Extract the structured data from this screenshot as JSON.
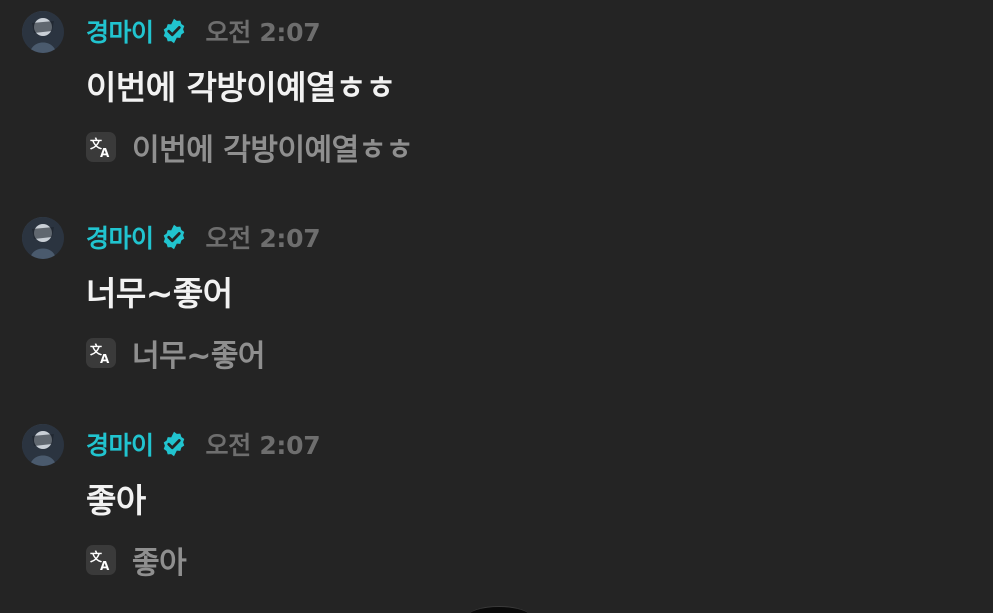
{
  "messages": [
    {
      "username": "경마이",
      "time": "오전 2:07",
      "text": "이번에 각방이예열ㅎㅎ",
      "translation": "이번에 각방이예열ㅎㅎ"
    },
    {
      "username": "경마이",
      "time": "오전 2:07",
      "text": "너무~좋어",
      "translation": "너무~좋어"
    },
    {
      "username": "경마이",
      "time": "오전 2:07",
      "text": "좋아",
      "translation": "좋아"
    }
  ],
  "icons": {
    "avatar": "user-avatar",
    "verified": "verified-badge-icon",
    "translate": "translate-icon"
  },
  "colors": {
    "background": "#242424",
    "username": "#21c4cf",
    "timestamp": "#6e6e6e",
    "message_text": "#f2f2f2",
    "translation_text": "#8f8f8f",
    "verified_badge": "#21c4cf"
  }
}
